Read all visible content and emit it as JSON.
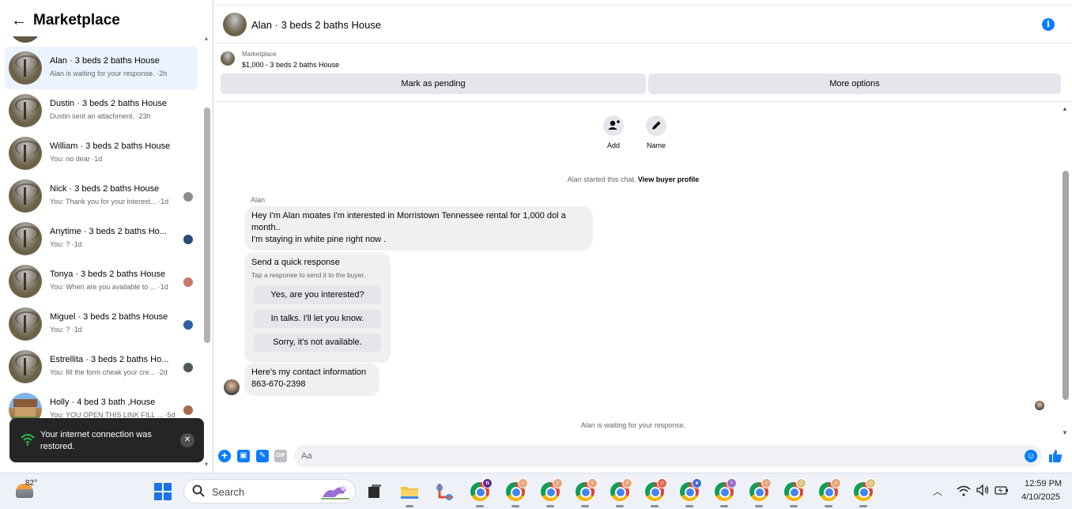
{
  "sidebar": {
    "title": "Marketplace",
    "conversations": [
      {
        "name": "Alan · 3 beds 2 baths House",
        "preview": "Alan is waiting for your response. ·2h"
      },
      {
        "name": "Dustin · 3 beds 2 baths House",
        "preview": "Dustin sent an attachment. ·23h"
      },
      {
        "name": "William · 3 beds 2 baths House",
        "preview": "You: no dear ·1d"
      },
      {
        "name": "Nick · 3 beds 2 baths House",
        "preview": "You: Thank you for your interest... ·1d"
      },
      {
        "name": "Anytime · 3 beds 2 baths Ho...",
        "preview": "You: ? ·1d"
      },
      {
        "name": "Tonya · 3 beds 2 baths House",
        "preview": "You: When are you available to ... ·1d"
      },
      {
        "name": "Miguel · 3 beds 2 baths House",
        "preview": "You: ? ·1d"
      },
      {
        "name": "Estrellita · 3 beds 2 baths Ho...",
        "preview": "You: fill the form cheak your cre... ·2d"
      },
      {
        "name": "Holly · 4 bed 3 bath ,House",
        "preview": "You: YOU OPEN THIS LINK FILL ... ·5d"
      }
    ]
  },
  "toast": {
    "message": "Your internet connection was restored.",
    "close_symbol": "✕"
  },
  "chat": {
    "title": "Alan · 3 beds 2 baths House",
    "listing": {
      "source": "Marketplace",
      "summary": "$1,000 - 3 beds 2 baths House",
      "pending_button": "Mark as pending",
      "more_button": "More options"
    },
    "actions": {
      "add_label": "Add",
      "name_label": "Name"
    },
    "started_text": "Alan started this chat.",
    "started_link": "View buyer profile",
    "sender": "Alan",
    "message1_line1": "Hey I'm Alan moates I'm interested in Morristown Tennessee rental for 1,000 dol a month..",
    "message1_line2": "I'm staying in white pine right now .",
    "quick_response": {
      "title": "Send a quick response",
      "subtitle": "Tap a response to send it to the buyer.",
      "options": [
        "Yes, are you interested?",
        "In talks. I'll let you know.",
        "Sorry, it's not available."
      ]
    },
    "message2_line1": "Here's my contact information",
    "message2_line2": "863-670-2398",
    "waiting_text": "Alan is waiting for your response.",
    "composer_placeholder": "Aa"
  },
  "taskbar": {
    "weather_temp": "82°",
    "search_label": "Search",
    "time": "12:59 PM",
    "date": "4/10/2025"
  },
  "icons": {
    "back": "back-arrow-icon",
    "info": "info-icon",
    "add_person": "add-person-icon",
    "pencil": "pencil-icon",
    "plus": "plus-circle-icon",
    "image": "image-icon",
    "sticker": "sticker-icon",
    "gif": "gif-icon",
    "emoji": "emoji-icon",
    "like": "thumbs-up-icon",
    "wifi": "wifi-icon"
  },
  "colors": {
    "accent": "#0a7cff",
    "active_conversation": "#eaf3ff",
    "toast_background": "#242526",
    "bubble": "#f0f0f0"
  }
}
